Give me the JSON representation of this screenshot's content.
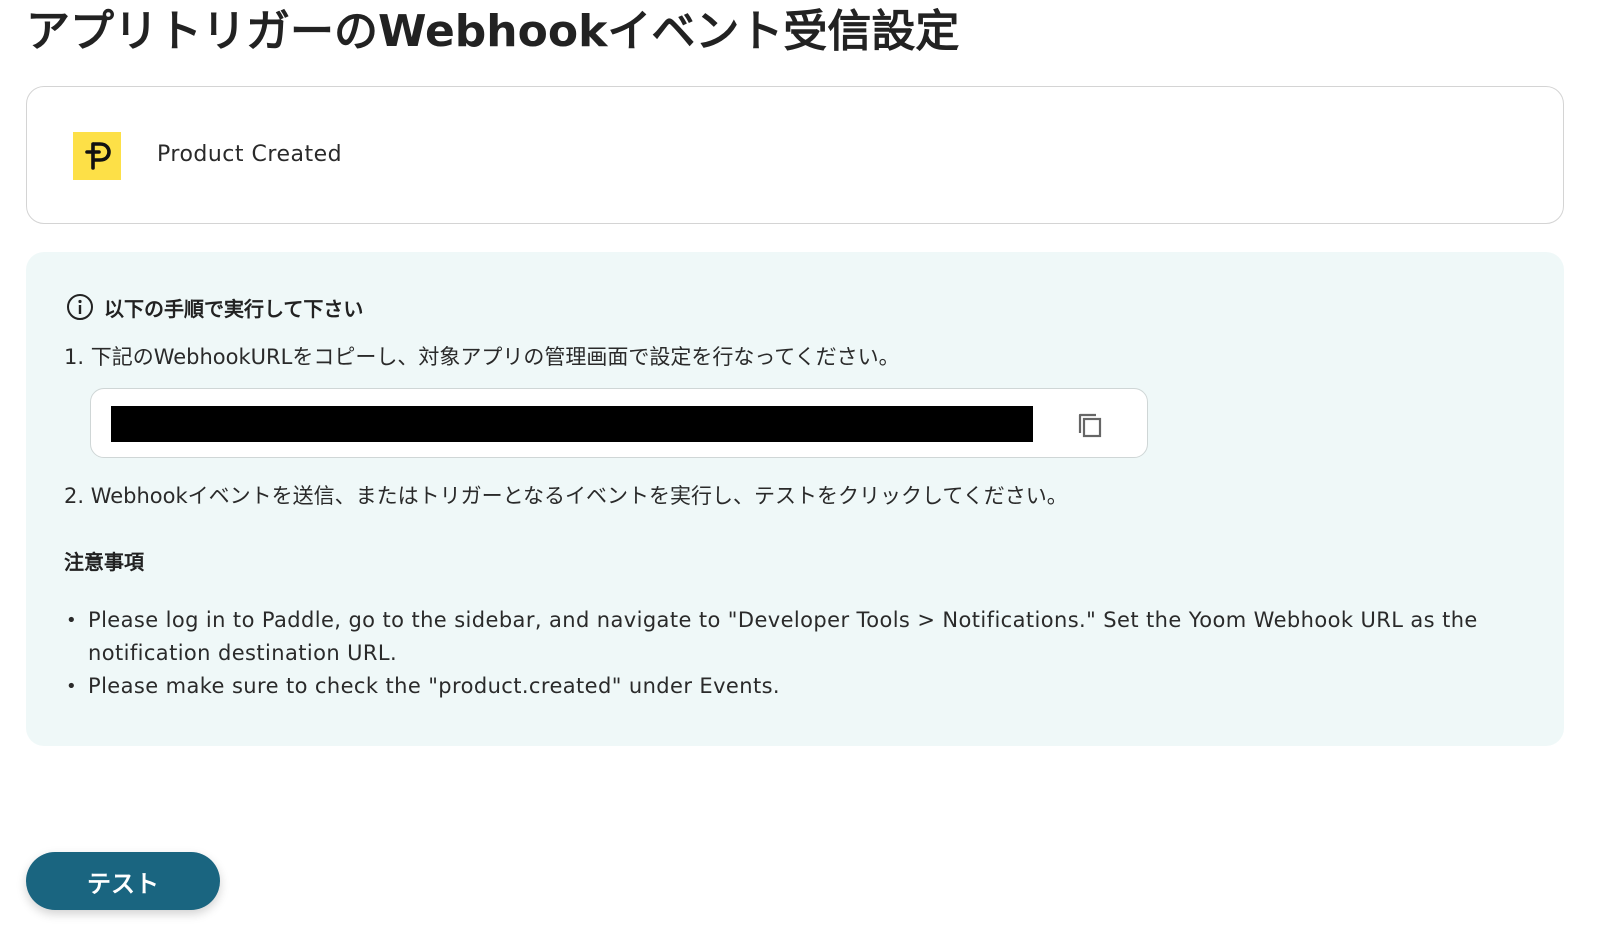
{
  "page": {
    "title": "アプリトリガーのWebhookイベント受信設定"
  },
  "trigger": {
    "app_icon": "paddle-logo-icon",
    "app_icon_color": "#fde047",
    "event_name": "Product Created"
  },
  "instructions": {
    "heading": "以下の手順で実行して下さい",
    "step1": "1. 下記のWebhookURLをコピーし、対象アプリの管理画面で設定を行なってください。",
    "webhook_url": "",
    "copy_icon": "copy-icon",
    "step2": "2. Webhookイベントを送信、またはトリガーとなるイベントを実行し、テストをクリックしてください。"
  },
  "notes": {
    "title": "注意事項",
    "items": [
      "Please log in to Paddle, go to the sidebar, and navigate to \"Developer Tools > Notifications.\" Set the Yoom Webhook URL as the notification destination URL.",
      "Please make sure to check the \"product.created\" under Events."
    ]
  },
  "actions": {
    "test_label": "テスト"
  },
  "colors": {
    "panel_background": "#eff8f8",
    "button_background": "#1a6580",
    "border": "#d4d4d4"
  }
}
